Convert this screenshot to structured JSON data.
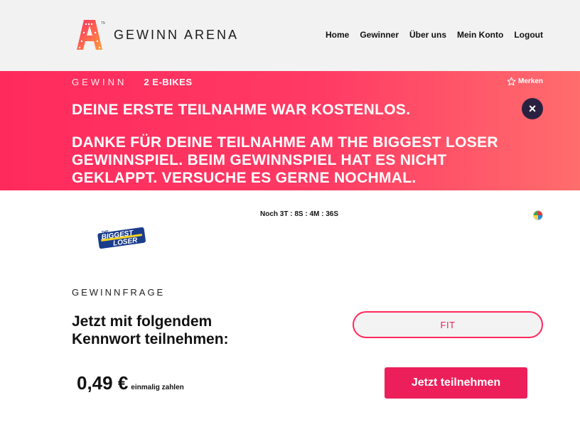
{
  "header": {
    "brand": "GEWINN ARENA",
    "logo_icon": "arena-a-logo-icon",
    "nav": [
      {
        "label": "Home"
      },
      {
        "label": "Gewinner"
      },
      {
        "label": "Über uns"
      },
      {
        "label": "Mein Konto"
      },
      {
        "label": "Logout"
      }
    ]
  },
  "banner": {
    "gewinn_label": "GEWINN",
    "prize": "2 E-BIKES",
    "merken_label": "Merken",
    "message_1": "Deine erste Teilnahme war kostenlos.",
    "message_2": "Danke für deine Teilnahme am The Biggest Loser Gewinnspiel. Beim Gewinnspiel hat es nicht geklappt. Versuche es gerne nochmal.",
    "close_symbol": "×",
    "accent_color": "#ff2a5c"
  },
  "content": {
    "countdown": "Noch 3T : 8S : 4M : 36S",
    "show_logo_line1": "THE",
    "show_logo_line2": "BIGGEST",
    "show_logo_line3": "LOSER",
    "gewinnfrage_label": "GEWINNFRAGE",
    "question_line1": "Jetzt mit folgendem",
    "question_line2": "Kennwort teilnehmen:",
    "keyword": "FIT",
    "price": "0,49 €",
    "price_note": "einmalig zahlen",
    "cta_label": "Jetzt teilnehmen",
    "cta_color": "#ec1f5a"
  }
}
